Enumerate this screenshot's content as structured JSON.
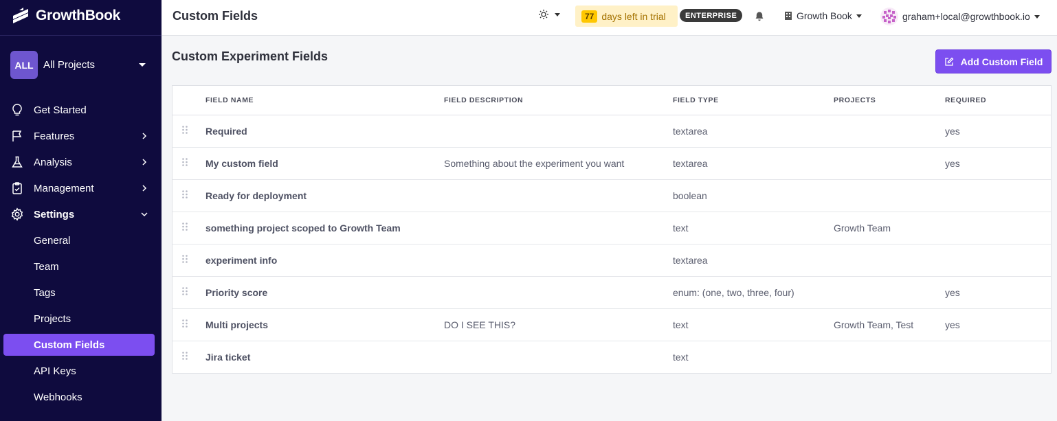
{
  "app": {
    "name": "GrowthBook"
  },
  "sidebar": {
    "project": {
      "badge": "ALL",
      "label": "All Projects"
    },
    "nav": [
      {
        "label": "Get Started",
        "icon": "lightbulb-icon"
      },
      {
        "label": "Features",
        "icon": "flag-icon"
      },
      {
        "label": "Analysis",
        "icon": "flask-icon"
      },
      {
        "label": "Management",
        "icon": "clipboard-icon"
      },
      {
        "label": "Settings",
        "icon": "gear-icon"
      }
    ],
    "settings_items": [
      "General",
      "Team",
      "Tags",
      "Projects",
      "Custom Fields",
      "API Keys",
      "Webhooks"
    ],
    "active_item": "Custom Fields"
  },
  "topbar": {
    "title": "Custom Fields",
    "trial_days": "77",
    "trial_text": "days left in trial",
    "plan_badge": "ENTERPRISE",
    "org_name": "Growth Book",
    "user_email": "graham+local@growthbook.io"
  },
  "main": {
    "section_title": "Custom Experiment Fields",
    "add_button": "Add Custom Field",
    "columns": [
      "FIELD NAME",
      "FIELD DESCRIPTION",
      "FIELD TYPE",
      "PROJECTS",
      "REQUIRED"
    ],
    "rows": [
      {
        "name": "Required",
        "description": "",
        "type": "textarea",
        "projects": "",
        "required": "yes"
      },
      {
        "name": "My custom field",
        "description": "Something about the experiment you want",
        "type": "textarea",
        "projects": "",
        "required": "yes"
      },
      {
        "name": "Ready for deployment",
        "description": "",
        "type": "boolean",
        "projects": "",
        "required": ""
      },
      {
        "name": "something project scoped to Growth Team",
        "description": "",
        "type": "text",
        "projects": "Growth Team",
        "required": ""
      },
      {
        "name": "experiment info",
        "description": "",
        "type": "textarea",
        "projects": "",
        "required": ""
      },
      {
        "name": "Priority score",
        "description": "",
        "type": "enum: (one, two, three, four)",
        "projects": "",
        "required": "yes"
      },
      {
        "name": "Multi projects",
        "description": "DO I SEE THIS?",
        "type": "text",
        "projects": "Growth Team, Test",
        "required": "yes"
      },
      {
        "name": "Jira ticket",
        "description": "",
        "type": "text",
        "projects": "",
        "required": ""
      }
    ]
  },
  "colors": {
    "sidebar_bg": "#0f0b3e",
    "accent": "#7c4ef0",
    "trial_bg": "#fff1c7"
  }
}
